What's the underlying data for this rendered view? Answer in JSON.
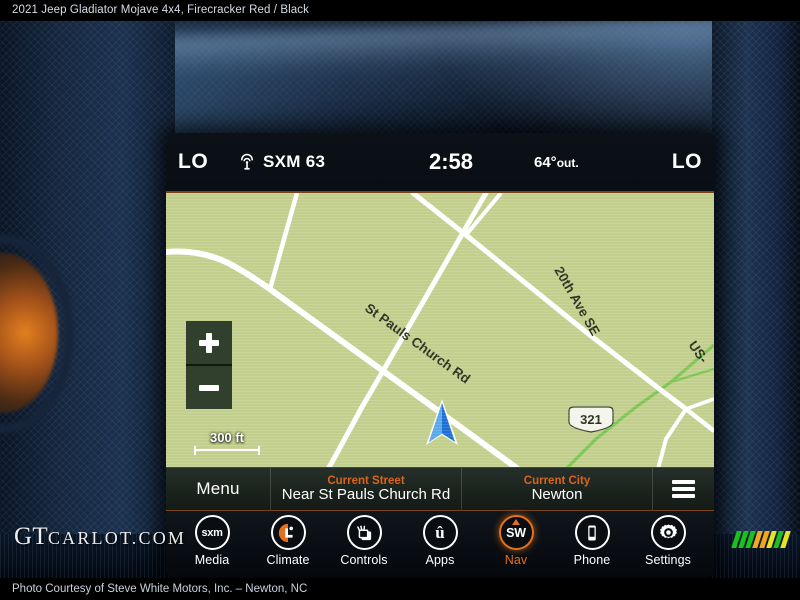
{
  "captions": {
    "top": "2021 Jeep Gladiator Mojave 4x4,  Firecracker Red / Black",
    "bottom": "Photo Courtesy of Steve White Motors, Inc. – Newton, NC"
  },
  "watermark": {
    "primary": "GT",
    "secondary": "CARLOT.COM",
    "bar_colors": [
      "#19c01e",
      "#19c01e",
      "#19c01e",
      "#f0a81c",
      "#f0a81c",
      "#e8e320",
      "#19c01e",
      "#e8e320"
    ]
  },
  "screen": {
    "status_bar": {
      "left_temp": "LO",
      "right_temp": "LO",
      "radio_icon": "satellite-antenna-icon",
      "radio_source": "SXM 63",
      "clock": "2:58",
      "outside_temp": "64°",
      "outside_temp_unit": "out."
    },
    "map": {
      "background_color": "#c2cf8c",
      "road_color": "#ffffff",
      "highway_color": "#86c85a",
      "vehicle_heading_arrow": "navigation-arrow",
      "zoom_in_label": "+",
      "zoom_out_label": "−",
      "scale": "300 ft",
      "labels": [
        {
          "text": "St Pauls Church Rd"
        },
        {
          "text": "20th Ave SE"
        },
        {
          "text": "US-"
        }
      ],
      "shields": [
        {
          "number": "321"
        }
      ]
    },
    "info_bar": {
      "menu_label": "Menu",
      "street_label": "Current Street",
      "street_value": "Near St Pauls Church Rd",
      "city_label": "Current City",
      "city_value": "Newton",
      "overflow_icon": "hamburger-menu-icon",
      "accent_color": "#d9651a"
    },
    "dock": {
      "active_index": 4,
      "active_color": "#e2711d",
      "items": [
        {
          "label": "Media",
          "icon": "sxm-logo-icon",
          "glyph": "sxm"
        },
        {
          "label": "Climate",
          "icon": "climate-seat-icon",
          "glyph": ""
        },
        {
          "label": "Controls",
          "icon": "vehicle-controls-icon",
          "glyph": ""
        },
        {
          "label": "Apps",
          "icon": "uconnect-apps-icon",
          "glyph": "û"
        },
        {
          "label": "Nav",
          "icon": "sw-compass-nav-icon",
          "glyph": "SW"
        },
        {
          "label": "Phone",
          "icon": "phone-icon",
          "glyph": ""
        },
        {
          "label": "Settings",
          "icon": "gear-icon",
          "glyph": ""
        }
      ]
    }
  }
}
